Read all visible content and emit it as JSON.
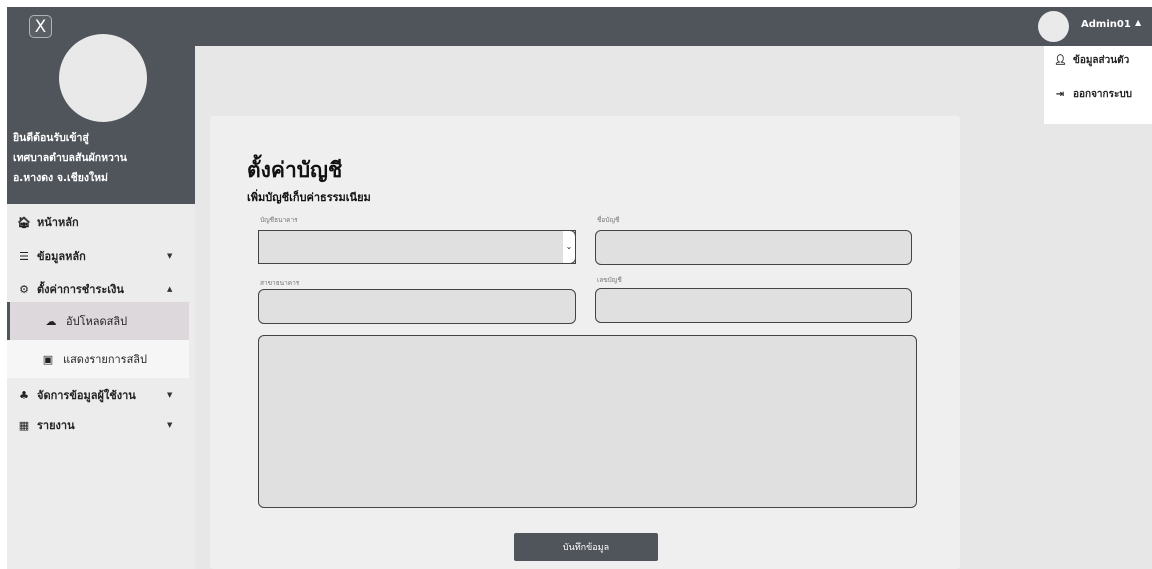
{
  "sidebar": {
    "close_label": "X",
    "welcome_lines": [
      "ยินดีต้อนรับเข้าสู่",
      "เทศบาลตำบลสันผักหวาน",
      "อ.หางดง จ.เชียงใหม่"
    ],
    "menu": [
      {
        "label": "หน้าหลัก",
        "icon": "home-icon",
        "glyph": "🏠︎"
      },
      {
        "label": "ข้อมูลหลัก",
        "icon": "database-icon",
        "glyph": "☰",
        "caret": "▼"
      },
      {
        "label": "ตั้งค่าการชำระเงิน",
        "icon": "gear-icon",
        "glyph": "⚙",
        "caret": "▲"
      }
    ],
    "submenu": [
      {
        "label": "อัปโหลดสลิป",
        "icon": "cloud-upload-icon",
        "glyph": "☁"
      },
      {
        "label": "แสดงรายการสลิป",
        "icon": "receipt-icon",
        "glyph": "▣"
      }
    ],
    "menu_bottom": [
      {
        "label": "จัดการข้อมูลผู้ใช้งาน",
        "icon": "users-icon",
        "glyph": "♣",
        "caret": "▼"
      },
      {
        "label": "รายงาน",
        "icon": "chart-icon",
        "glyph": "▦",
        "caret": "▼"
      }
    ]
  },
  "topbar": {
    "user_name": "Admin01",
    "caret": "▲",
    "dropdown": [
      {
        "label": "ข้อมูลส่วนตัว",
        "icon": "user-icon",
        "glyph": "👤︎"
      },
      {
        "label": "ออกจากระบบ",
        "icon": "logout-icon",
        "glyph": "⇥"
      }
    ]
  },
  "form": {
    "title": "ตั้งค่าบัญชี",
    "subtitle": "เพิ่มบัญชีเก็บค่าธรรมเนียม",
    "labels": {
      "bank_account": "บัญชีธนาคาร",
      "account_name": "ชื่อบัญชี",
      "bank_branch": "สาขาธนาคาร",
      "account_number": "เลขบัญชี"
    },
    "select_arrow": "⌄",
    "save_label": "บันทึกข้อมูล"
  }
}
